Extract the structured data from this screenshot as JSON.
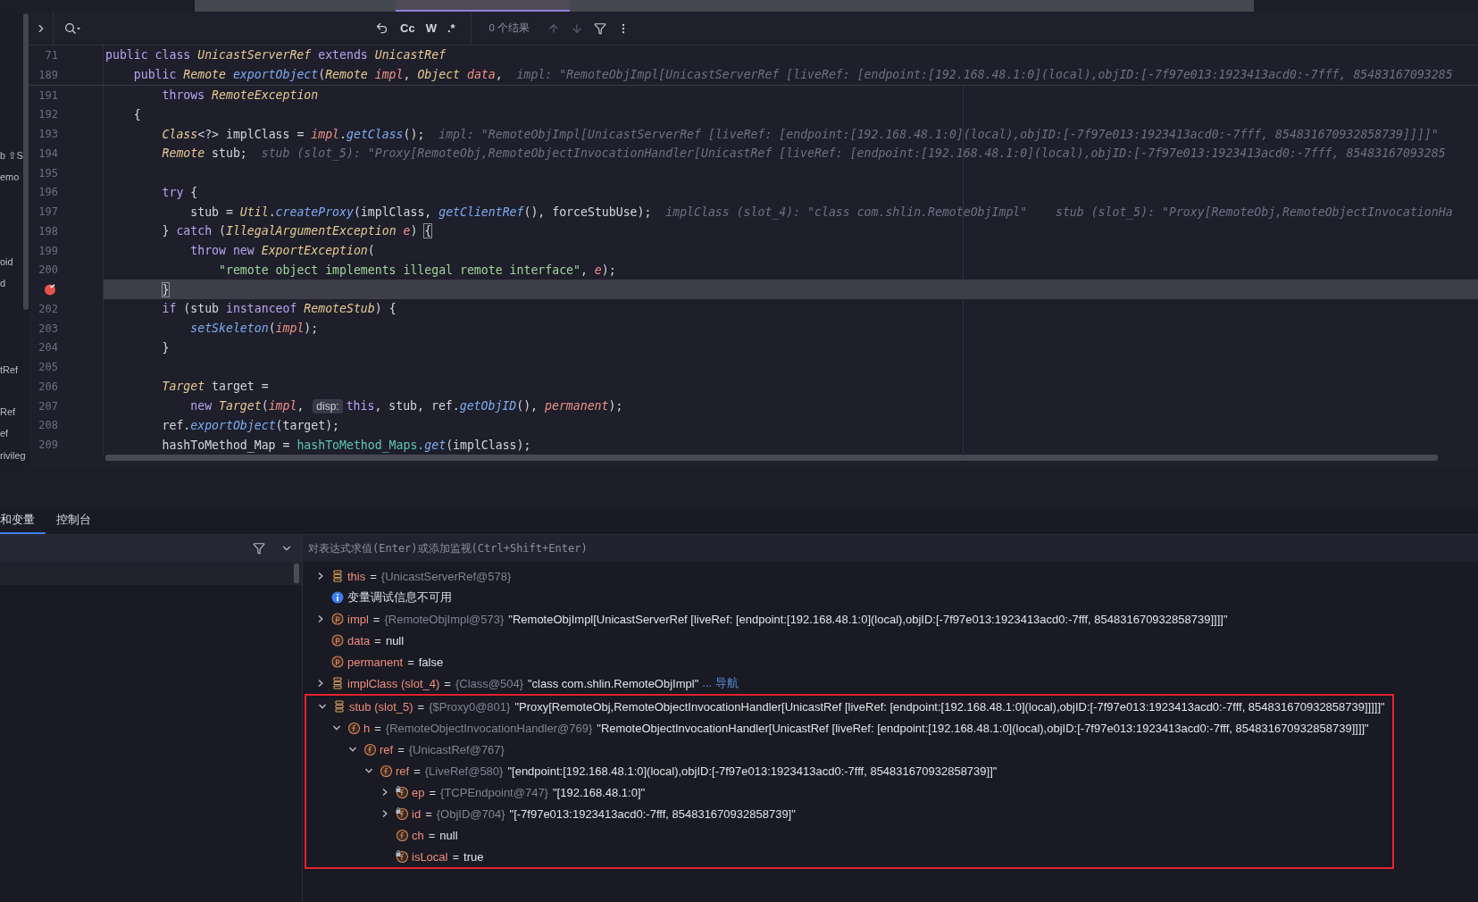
{
  "tab_strip": [
    {
      "selected": false
    },
    {
      "selected": true
    },
    {
      "selected": false
    }
  ],
  "sidebar_fragments": [
    "b ⇧S",
    "emo",
    "oid",
    "d",
    "tRef",
    "Ref",
    "ef",
    "rivileg"
  ],
  "find_bar": {
    "options": [
      "Cc",
      "W",
      ".*"
    ],
    "result_count": "0 个结果",
    "navigation_disabled": true
  },
  "editor": {
    "sticky_lines": [
      {
        "number": "71",
        "segments": [
          {
            "kind": "code",
            "tokens": [
              {
                "kind": "kw",
                "text": "public "
              },
              {
                "kind": "kw",
                "text": "class "
              },
              {
                "kind": "type",
                "text": "UnicastServerRef "
              },
              {
                "kind": "kw",
                "text": "extends "
              },
              {
                "kind": "type",
                "text": "UnicastRef"
              }
            ]
          }
        ]
      },
      {
        "number": "189",
        "segments": [
          {
            "kind": "code",
            "tokens": [
              {
                "kind": "kw",
                "text": "    public "
              },
              {
                "kind": "type",
                "text": "Remote "
              },
              {
                "kind": "method",
                "text": "exportObject"
              },
              {
                "kind": "plain",
                "text": "("
              },
              {
                "kind": "type",
                "text": "Remote "
              },
              {
                "kind": "param",
                "text": "impl"
              },
              {
                "kind": "plain",
                "text": ", "
              },
              {
                "kind": "type",
                "text": "Object "
              },
              {
                "kind": "param",
                "text": "data"
              },
              {
                "kind": "plain",
                "text": ","
              }
            ]
          },
          {
            "kind": "hint",
            "text": "impl: \"RemoteObjImpl[UnicastServerRef [liveRef: [endpoint:[192.168.48.1:0](local),objID:[-7f97e013:1923413acd0:-7fff, 85483167093285"
          }
        ]
      }
    ],
    "lines": [
      {
        "number": "191",
        "breakpoint": false,
        "current": false,
        "segments": [
          {
            "kind": "code",
            "tokens": [
              {
                "kind": "kw",
                "text": "        throws "
              },
              {
                "kind": "type",
                "text": "RemoteException"
              }
            ]
          }
        ]
      },
      {
        "number": "192",
        "breakpoint": false,
        "current": false,
        "segments": [
          {
            "kind": "code",
            "tokens": [
              {
                "kind": "plain",
                "text": "    {"
              }
            ]
          }
        ]
      },
      {
        "number": "193",
        "breakpoint": false,
        "current": false,
        "segments": [
          {
            "kind": "code",
            "tokens": [
              {
                "kind": "type",
                "text": "        Class"
              },
              {
                "kind": "plain",
                "text": "<?> implClass = "
              },
              {
                "kind": "param",
                "text": "impl"
              },
              {
                "kind": "plain",
                "text": "."
              },
              {
                "kind": "method",
                "text": "getClass"
              },
              {
                "kind": "plain",
                "text": "();"
              }
            ]
          },
          {
            "kind": "hint",
            "text": "impl: \"RemoteObjImpl[UnicastServerRef [liveRef: [endpoint:[192.168.48.1:0](local),objID:[-7f97e013:1923413acd0:-7fff, 854831670932858739]]]]\""
          }
        ]
      },
      {
        "number": "194",
        "breakpoint": false,
        "current": false,
        "segments": [
          {
            "kind": "code",
            "tokens": [
              {
                "kind": "type",
                "text": "        Remote "
              },
              {
                "kind": "plain",
                "text": "stub;"
              }
            ]
          },
          {
            "kind": "hint",
            "text": "stub (slot_5): \"Proxy[RemoteObj,RemoteObjectInvocationHandler[UnicastRef [liveRef: [endpoint:[192.168.48.1:0](local),objID:[-7f97e013:1923413acd0:-7fff, 85483167093285"
          }
        ]
      },
      {
        "number": "195",
        "breakpoint": false,
        "current": false
      },
      {
        "number": "196",
        "breakpoint": false,
        "current": false,
        "segments": [
          {
            "kind": "code",
            "tokens": [
              {
                "kind": "kw",
                "text": "        try "
              },
              {
                "kind": "plain",
                "text": "{"
              }
            ]
          }
        ]
      },
      {
        "number": "197",
        "breakpoint": false,
        "current": false,
        "segments": [
          {
            "kind": "code",
            "tokens": [
              {
                "kind": "plain",
                "text": "            stub = "
              },
              {
                "kind": "type",
                "text": "Util"
              },
              {
                "kind": "plain",
                "text": "."
              },
              {
                "kind": "method",
                "text": "createProxy"
              },
              {
                "kind": "plain",
                "text": "(implClass, "
              },
              {
                "kind": "method",
                "text": "getClientRef"
              },
              {
                "kind": "plain",
                "text": "(), forceStubUse);"
              }
            ]
          },
          {
            "kind": "hint",
            "text": "implClass (slot_4): \"class com.shlin.RemoteObjImpl\""
          },
          {
            "kind": "hint",
            "text": "stub (slot_5): \"Proxy[RemoteObj,RemoteObjectInvocationHa"
          }
        ]
      },
      {
        "number": "198",
        "breakpoint": false,
        "current": false,
        "segments": [
          {
            "kind": "code",
            "tokens": [
              {
                "kind": "plain",
                "text": "        } "
              },
              {
                "kind": "kw",
                "text": "catch "
              },
              {
                "kind": "plain",
                "text": "("
              },
              {
                "kind": "type",
                "text": "IllegalArgumentException "
              },
              {
                "kind": "param",
                "text": "e"
              },
              {
                "kind": "plain",
                "text": ") "
              },
              {
                "kind": "brace",
                "text": "{"
              }
            ]
          }
        ]
      },
      {
        "number": "199",
        "breakpoint": false,
        "current": false,
        "segments": [
          {
            "kind": "code",
            "tokens": [
              {
                "kind": "kw",
                "text": "            throw new "
              },
              {
                "kind": "type",
                "text": "ExportException"
              },
              {
                "kind": "plain",
                "text": "("
              }
            ]
          }
        ]
      },
      {
        "number": "200",
        "breakpoint": false,
        "current": false,
        "segments": [
          {
            "kind": "code",
            "tokens": [
              {
                "kind": "str",
                "text": "                \"remote object implements illegal remote interface\""
              },
              {
                "kind": "plain",
                "text": ", "
              },
              {
                "kind": "param",
                "text": "e"
              },
              {
                "kind": "plain",
                "text": ");"
              }
            ]
          }
        ]
      },
      {
        "breakpoint": true,
        "current": true,
        "segments": [
          {
            "kind": "code",
            "tokens": [
              {
                "kind": "brace",
                "text": "        }"
              }
            ]
          }
        ]
      },
      {
        "number": "202",
        "breakpoint": false,
        "current": false,
        "segments": [
          {
            "kind": "code",
            "tokens": [
              {
                "kind": "kw",
                "text": "        if "
              },
              {
                "kind": "plain",
                "text": "(stub "
              },
              {
                "kind": "kw",
                "text": "instanceof "
              },
              {
                "kind": "type",
                "text": "RemoteStub"
              },
              {
                "kind": "plain",
                "text": ") {"
              }
            ]
          }
        ]
      },
      {
        "number": "203",
        "breakpoint": false,
        "current": false,
        "segments": [
          {
            "kind": "code",
            "tokens": [
              {
                "kind": "method",
                "text": "            setSkeleton"
              },
              {
                "kind": "plain",
                "text": "("
              },
              {
                "kind": "param",
                "text": "impl"
              },
              {
                "kind": "plain",
                "text": ");"
              }
            ]
          }
        ]
      },
      {
        "number": "204",
        "breakpoint": false,
        "current": false,
        "segments": [
          {
            "kind": "code",
            "tokens": [
              {
                "kind": "plain",
                "text": "        }"
              }
            ]
          }
        ]
      },
      {
        "number": "205",
        "breakpoint": false,
        "current": false
      },
      {
        "number": "206",
        "breakpoint": false,
        "current": false,
        "segments": [
          {
            "kind": "code",
            "tokens": [
              {
                "kind": "type",
                "text": "        Target "
              },
              {
                "kind": "plain",
                "text": "target ="
              }
            ]
          }
        ]
      },
      {
        "number": "207",
        "breakpoint": false,
        "current": false,
        "segments": [
          {
            "kind": "code",
            "tokens": [
              {
                "kind": "kw",
                "text": "            new "
              },
              {
                "kind": "type",
                "text": "Target"
              },
              {
                "kind": "plain",
                "text": "("
              },
              {
                "kind": "param",
                "text": "impl"
              },
              {
                "kind": "plain",
                "text": ", "
              }
            ]
          },
          {
            "kind": "inlay",
            "text": "disp:"
          },
          {
            "kind": "code",
            "tokens": [
              {
                "kind": "kw",
                "text": "this"
              },
              {
                "kind": "plain",
                "text": ", stub, ref."
              },
              {
                "kind": "method",
                "text": "getObjID"
              },
              {
                "kind": "plain",
                "text": "(), "
              },
              {
                "kind": "param",
                "text": "permanent"
              },
              {
                "kind": "plain",
                "text": ");"
              }
            ]
          }
        ]
      },
      {
        "number": "208",
        "breakpoint": false,
        "current": false,
        "segments": [
          {
            "kind": "code",
            "tokens": [
              {
                "kind": "plain",
                "text": "        ref."
              },
              {
                "kind": "method",
                "text": "exportObject"
              },
              {
                "kind": "plain",
                "text": "(target);"
              }
            ]
          }
        ]
      },
      {
        "number": "209",
        "breakpoint": false,
        "current": false,
        "segments": [
          {
            "kind": "code",
            "tokens": [
              {
                "kind": "plain",
                "text": "        hashToMethod_Map = "
              },
              {
                "kind": "static",
                "text": "hashToMethod_Maps."
              },
              {
                "kind": "method",
                "text": "get"
              },
              {
                "kind": "plain",
                "text": "(implClass);"
              }
            ]
          }
        ]
      }
    ]
  },
  "debug_panel": {
    "tabs": [
      {
        "label": "和变量",
        "selected": true
      },
      {
        "label": "控制台",
        "selected": false
      }
    ],
    "expression_placeholder": "对表达式求值(Enter)或添加监视(Ctrl+Shift+Enter)",
    "tree": [
      {
        "kind": "local",
        "expanded": false,
        "highlighted": false,
        "name": "this",
        "eq": "=",
        "type": "{UnicastServerRef@578}"
      },
      {
        "kind": "info",
        "highlighted": false,
        "text": "变量调试信息不可用"
      },
      {
        "kind": "parameter",
        "expanded": false,
        "highlighted": false,
        "name": "impl",
        "eq": "=",
        "type": "{RemoteObjImpl@573}",
        "value": "\"RemoteObjImpl[UnicastServerRef [liveRef: [endpoint:[192.168.48.1:0](local),objID:[-7f97e013:1923413acd0:-7fff, 854831670932858739]]]]\""
      },
      {
        "kind": "parameter",
        "highlighted": false,
        "name": "data",
        "eq": "=",
        "value": "null"
      },
      {
        "kind": "parameter",
        "highlighted": false,
        "name": "permanent",
        "eq": "=",
        "value": "false"
      },
      {
        "kind": "local",
        "expanded": false,
        "highlighted": false,
        "name": "implClass (slot_4)",
        "eq": "=",
        "type": "{Class@504}",
        "value": "\"class com.shlin.RemoteObjImpl\"",
        "link": "... 导航"
      },
      {
        "kind": "local",
        "expanded": true,
        "highlighted": true,
        "name": "stub (slot_5)",
        "eq": "=",
        "type": "{$Proxy0@801}",
        "value": "\"Proxy[RemoteObj,RemoteObjectInvocationHandler[UnicastRef [liveRef: [endpoint:[192.168.48.1:0](local),objID:[-7f97e013:1923413acd0:-7fff, 854831670932858739]]]]]\"",
        "children": [
          {
            "kind": "field",
            "expanded": true,
            "highlighted": false,
            "name": "h",
            "eq": "=",
            "type": "{RemoteObjectInvocationHandler@769}",
            "value": "\"RemoteObjectInvocationHandler[UnicastRef [liveRef: [endpoint:[192.168.48.1:0](local),objID:[-7f97e013:1923413acd0:-7fff, 854831670932858739]]]]\"",
            "children": [
              {
                "kind": "field",
                "expanded": true,
                "highlighted": false,
                "name": "ref",
                "eq": "=",
                "type": "{UnicastRef@767}",
                "children": [
                  {
                    "kind": "field",
                    "expanded": true,
                    "highlighted": false,
                    "name": "ref",
                    "eq": "=",
                    "type": "{LiveRef@580}",
                    "value": "\"[endpoint:[192.168.48.1:0](local),objID:[-7f97e013:1923413acd0:-7fff, 854831670932858739]]\"",
                    "children": [
                      {
                        "kind": "final_field",
                        "expanded": false,
                        "highlighted": false,
                        "name": "ep",
                        "eq": "=",
                        "type": "{TCPEndpoint@747}",
                        "value": "\"[192.168.48.1:0]\""
                      },
                      {
                        "kind": "final_field",
                        "expanded": false,
                        "highlighted": false,
                        "name": "id",
                        "eq": "=",
                        "type": "{ObjID@704}",
                        "value": "\"[-7f97e013:1923413acd0:-7fff, 854831670932858739]\""
                      },
                      {
                        "kind": "field",
                        "highlighted": false,
                        "name": "ch",
                        "eq": "=",
                        "value": "null"
                      },
                      {
                        "kind": "final_field",
                        "highlighted": false,
                        "name": "isLocal",
                        "eq": "=",
                        "value": "true"
                      }
                    ]
                  }
                ]
              }
            ]
          }
        ]
      }
    ]
  }
}
